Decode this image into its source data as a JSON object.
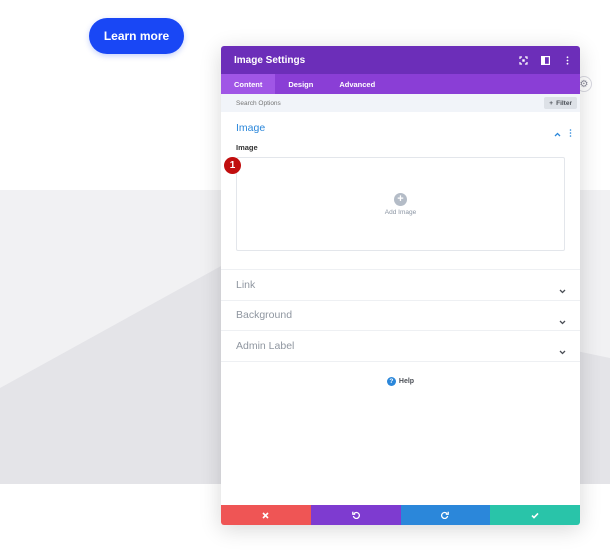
{
  "page": {
    "cta_label": "Learn more",
    "colors": {
      "cta": "#1947f5",
      "band": "#f1f1f3"
    }
  },
  "panel": {
    "title": "Image Settings",
    "header_icons": [
      "expand-icon",
      "sidebar-layout-icon",
      "more-vertical-icon"
    ],
    "tabs": [
      {
        "label": "Content",
        "active": true
      },
      {
        "label": "Design",
        "active": false
      },
      {
        "label": "Advanced",
        "active": false
      }
    ],
    "search": {
      "placeholder": "Search Options",
      "filter_label": "Filter"
    },
    "sections": {
      "image": {
        "title": "Image",
        "field_label": "Image",
        "upload_label": "Add Image"
      },
      "link": {
        "title": "Link"
      },
      "background": {
        "title": "Background"
      },
      "admin_label": {
        "title": "Admin Label"
      }
    },
    "help_label": "Help",
    "footer": [
      "discard-icon",
      "undo-icon",
      "redo-icon",
      "save-check-icon"
    ],
    "colors": {
      "header": "#6c2eb9",
      "tabs": "#8a3ed6",
      "accent": "#2b87da",
      "discard": "#ef5555",
      "undo": "#7e3bd0",
      "redo": "#2b87da",
      "save": "#29c4a9"
    }
  },
  "annotation": {
    "step": "1"
  }
}
